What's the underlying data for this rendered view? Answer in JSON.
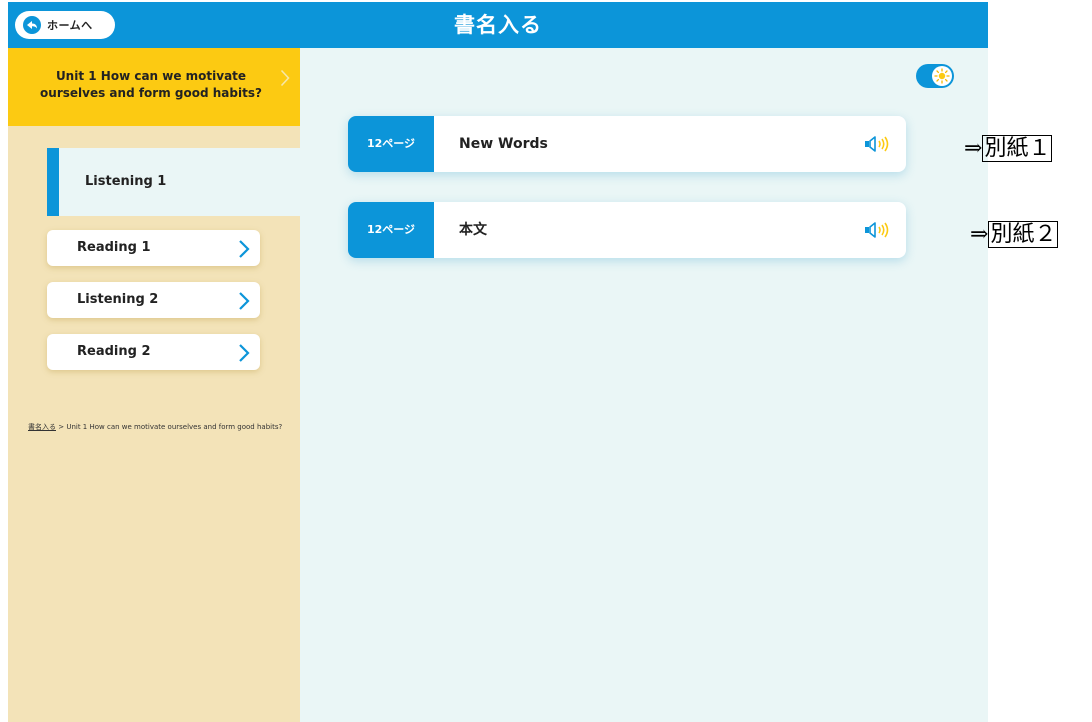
{
  "header": {
    "home_label": "ホームへ",
    "title": "書名入る"
  },
  "sidebar": {
    "unit_title": "Unit 1 How can we motivate ourselves and form good habits?",
    "active_tab": "Listening 1",
    "items": [
      {
        "label": "Reading 1"
      },
      {
        "label": "Listening 2"
      },
      {
        "label": "Reading 2"
      }
    ],
    "breadcrumb": {
      "link": "書名入る",
      "separator": " > ",
      "current": "Unit 1 How can we motivate ourselves and form good habits?"
    }
  },
  "main": {
    "cards": [
      {
        "page": "12ページ",
        "label": "New Words"
      },
      {
        "page": "12ページ",
        "label": "本文"
      }
    ]
  },
  "annotations": [
    {
      "arrow": "⇒",
      "text": "別紙１"
    },
    {
      "arrow": "⇒",
      "text": "別紙２"
    }
  ],
  "colors": {
    "primary": "#0c95d9",
    "unit_header": "#fcca12",
    "sidebar_bg": "#f3e3b8",
    "main_bg": "#eaf6f6"
  },
  "icons": {
    "home": "back-arrow-icon",
    "audio": "speaker-icon",
    "theme_toggle": "sun-icon",
    "nav": "chevron-right-icon"
  }
}
